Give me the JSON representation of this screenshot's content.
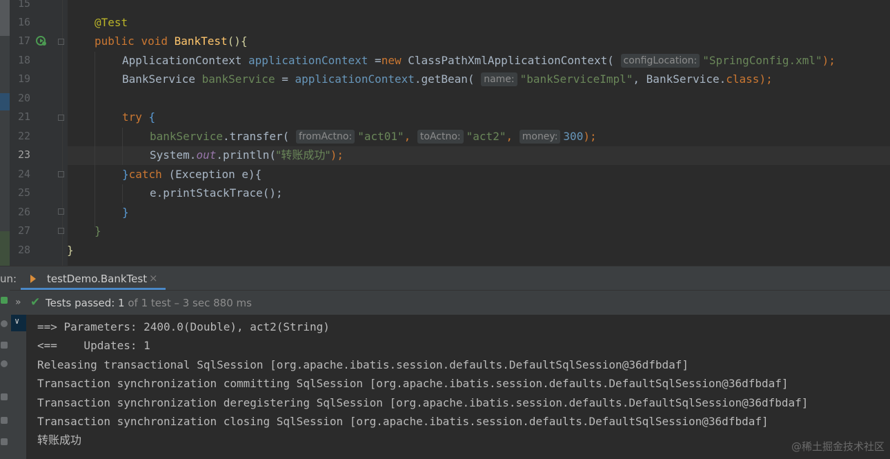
{
  "editor": {
    "line_numbers": [
      "15",
      "16",
      "17",
      "18",
      "19",
      "20",
      "21",
      "22",
      "23",
      "24",
      "25",
      "26",
      "27",
      "28"
    ],
    "current_line": "23",
    "code": {
      "annotation": "@Test",
      "kw_public": "public",
      "kw_void": "void",
      "method_name": "BankTest",
      "l17_end": "(){",
      "l18_type": "ApplicationContext",
      "l18_var": "applicationContext",
      "l18_eq": " =",
      "kw_new": "new",
      "l18_class": "ClassPathXmlApplicationContext(",
      "hint_config": "configLocation:",
      "str_config": "\"SpringConfig.xml\"",
      "l18_end": ");",
      "l19_type": "BankService",
      "l19_var": "bankService",
      "l19_eq": " = ",
      "l19_ctx": "applicationContext",
      "l19_call": ".getBean(",
      "hint_name": "name:",
      "str_impl": "\"bankServiceImpl\"",
      "l19_sep": ", BankService.",
      "kw_class": "class",
      "l19_end": ");",
      "kw_try": "try",
      "brace_open": "{",
      "l22_var": "bankService",
      "l22_call": ".transfer(",
      "hint_from": "fromActno:",
      "str_from": "\"act01\"",
      "comma": ",",
      "hint_to": "toActno:",
      "str_to": "\"act2\"",
      "hint_money": "money:",
      "num_money": "300",
      "l22_end": ");",
      "l23_sys": "System.",
      "l23_out": "out",
      "l23_call": ".println(",
      "str_success": "\"转账成功\"",
      "l23_end": ");",
      "brace_close": "}",
      "kw_catch": "catch",
      "l24_mid": " (Exception e){",
      "l25_text": "e.printStackTrace();",
      "close_inner": "}",
      "close_method": "}",
      "close_class": "}"
    }
  },
  "run_panel": {
    "label": "un:",
    "tab_label": "testDemo.BankTest",
    "tab_close": "×",
    "chevron": "»",
    "check": "✔",
    "status_prefix": "Tests passed: ",
    "status_count": "1",
    "status_rest": " of 1 test – 3 sec 880 ms",
    "tree_chevron": "∨",
    "console_lines": [
      "==> Parameters: 2400.0(Double), act2(String)",
      "<==    Updates: 1",
      "Releasing transactional SqlSession [org.apache.ibatis.session.defaults.DefaultSqlSession@36dfbdaf]",
      "Transaction synchronization committing SqlSession [org.apache.ibatis.session.defaults.DefaultSqlSession@36dfbdaf]",
      "Transaction synchronization deregistering SqlSession [org.apache.ibatis.session.defaults.DefaultSqlSession@36dfbdaf]",
      "Transaction synchronization closing SqlSession [org.apache.ibatis.session.defaults.DefaultSqlSession@36dfbdaf]",
      "转账成功"
    ]
  },
  "watermark": "@稀土掘金技术社区",
  "colors": {
    "editor_bg": "#2b2b2b",
    "keyword": "#cc7832",
    "string": "#6a8759",
    "method": "#ffc66d",
    "field": "#9876aa",
    "success": "#499c54",
    "tab_underline": "#4a88c7"
  },
  "icons": [
    "run-test-icon",
    "fold-marker-icon",
    "junit-tab-icon",
    "close-icon",
    "check-icon",
    "chevron-icon"
  ]
}
